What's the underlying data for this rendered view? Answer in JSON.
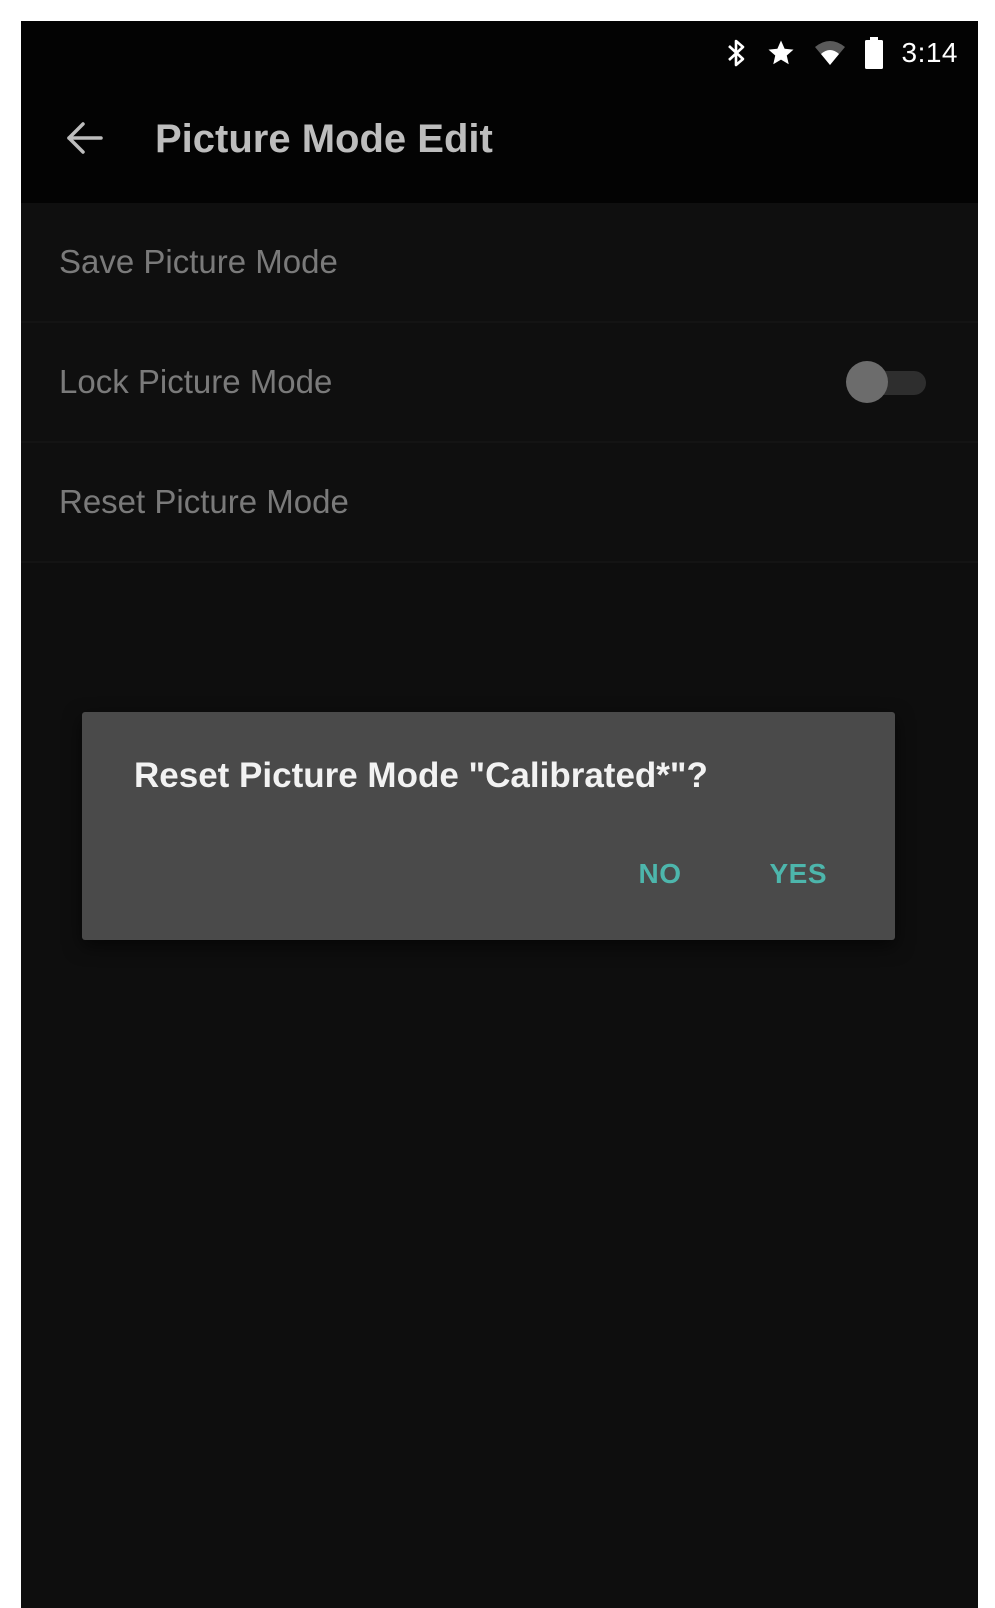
{
  "status_bar": {
    "time": "3:14",
    "icons": [
      "bluetooth-icon",
      "star-icon",
      "wifi-icon",
      "battery-icon"
    ]
  },
  "header": {
    "back_icon": "arrow-back-icon",
    "title": "Picture Mode Edit"
  },
  "menu": {
    "items": [
      {
        "label": "Save Picture Mode"
      },
      {
        "label": "Lock Picture Mode",
        "toggle": "off"
      },
      {
        "label": "Reset Picture Mode"
      }
    ]
  },
  "dialog": {
    "message": "Reset Picture Mode \"Calibrated*\"?",
    "no_label": "NO",
    "yes_label": "YES"
  },
  "colors": {
    "accent": "#4db6ac",
    "background": "#0e0e0e",
    "dialog": "#4a4a4a"
  }
}
